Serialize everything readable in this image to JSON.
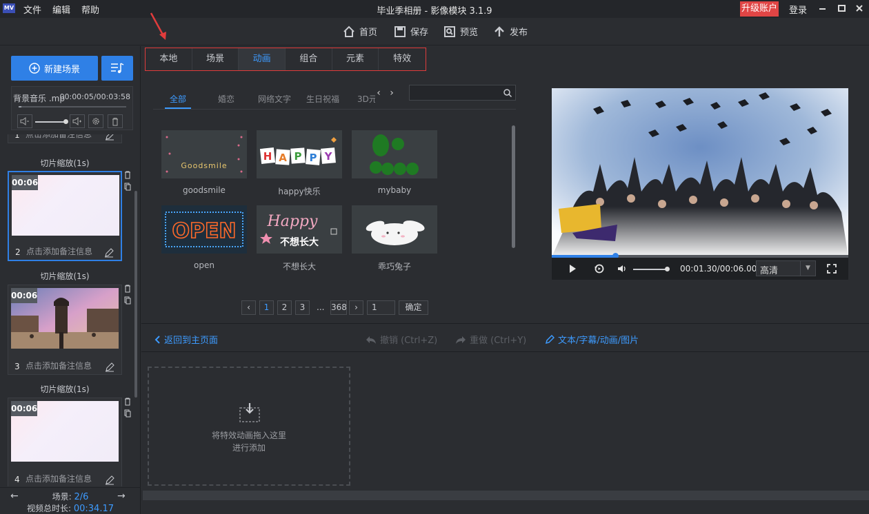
{
  "app": {
    "logo": "MV",
    "menu": [
      "文件",
      "编辑",
      "帮助"
    ],
    "title": "毕业季相册 - 影像模块 3.1.9",
    "upgrade": "升级账户",
    "login": "登录"
  },
  "toolbar": {
    "home": "首页",
    "save": "保存",
    "preview": "预览",
    "publish": "发布"
  },
  "left": {
    "new_scene": "新建场景",
    "music_name": "背景音乐 .mp",
    "music_time": "00:00:05/00:03:58",
    "partial_note": "点击添加备注信息",
    "partial_num": "1",
    "scenes": [
      {
        "caption": "切片缩放(1s)",
        "duration": "00:06",
        "num": "2",
        "note": "点击添加备注信息"
      },
      {
        "caption": "切片缩放(1s)",
        "duration": "00:06",
        "num": "3",
        "note": "点击添加备注信息"
      },
      {
        "caption": "切片缩放(1s)",
        "duration": "00:06",
        "num": "4",
        "note": "点击添加备注信息"
      }
    ],
    "footer": {
      "scene_label": "场景:",
      "scene_index": "2/6",
      "total_label": "视频总时长:",
      "total_value": "00:34.17"
    }
  },
  "center": {
    "tabs": [
      "本地",
      "场景",
      "动画",
      "组合",
      "元素",
      "特效"
    ],
    "sub_tabs": [
      "全部",
      "婚恋",
      "网络文字",
      "生日祝福",
      "3D元"
    ],
    "items": [
      {
        "label": "goodsmile",
        "art": "Goodsmile"
      },
      {
        "label": "happy快乐",
        "art": "HAPPY"
      },
      {
        "label": "mybaby",
        "art": ""
      },
      {
        "label": "open",
        "art": "OPEN"
      },
      {
        "label": "不想长大",
        "art": "Happy"
      },
      {
        "label": "乖巧兔子",
        "art": ""
      }
    ],
    "art_subtitle": "不想长大",
    "pager": {
      "pages": [
        "1",
        "2",
        "3"
      ],
      "dots": "...",
      "last": "368",
      "jump_value": "1",
      "confirm": "确定"
    }
  },
  "preview": {
    "time": "00:01.30/00:06.00",
    "quality": "高清",
    "progress": 0.217
  },
  "edit": {
    "back": "返回到主页面",
    "undo": "撤销 (Ctrl+Z)",
    "redo": "重做 (Ctrl+Y)",
    "text": "文本/字幕/动画/图片",
    "drop_line1": "将特效动画拖入这里",
    "drop_line2": "进行添加"
  },
  "colors": {
    "accent": "#3d9bff",
    "button": "#2f80e6",
    "upgrade": "#e04545",
    "highlight_box": "#e13c3c"
  }
}
